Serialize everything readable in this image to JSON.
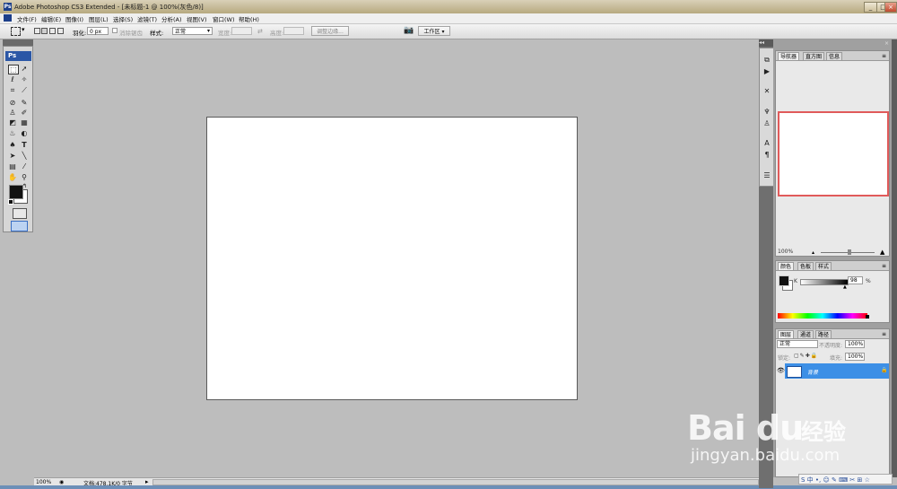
{
  "window": {
    "title": "Adobe Photoshop CS3 Extended - [未标题-1 @ 100%(灰色/8)]",
    "app_badge": "Ps",
    "controls": [
      "_",
      "□",
      "×"
    ]
  },
  "menu": [
    "文件(F)",
    "编辑(E)",
    "图像(I)",
    "图层(L)",
    "选择(S)",
    "滤镜(T)",
    "分析(A)",
    "视图(V)",
    "窗口(W)",
    "帮助(H)"
  ],
  "options": {
    "feather_label": "羽化:",
    "feather_value": "0 px",
    "antialias_label": "消除锯齿",
    "style_label": "样式:",
    "style_value": "正常",
    "width_label": "宽度:",
    "height_label": "高度:",
    "refine_edge_button": "调整边缘...",
    "workspace_button": "工作区 ▾"
  },
  "status": {
    "zoom": "100%",
    "doc_info": "文档:478.1K/0 字节"
  },
  "navigator": {
    "tabs": [
      "导航器",
      "直方图",
      "信息"
    ],
    "zoom": "100%"
  },
  "color_panel": {
    "tabs": [
      "颜色",
      "色板",
      "样式"
    ],
    "channel_label": "K",
    "value": "98",
    "unit": "%"
  },
  "layers_panel": {
    "tabs": [
      "图层",
      "通道",
      "路径"
    ],
    "blend_mode": "正常",
    "opacity_label": "不透明度:",
    "opacity_value": "100%",
    "lock_label": "锁定:",
    "fill_label": "填充:",
    "fill_value": "100%",
    "layer_name": "背景"
  },
  "watermark": {
    "brand": "Bai  du",
    "brand_cn": "经验",
    "url": "jingyan.baidu.com"
  },
  "ime_bar": "S 中 •, ☺ ✎ ⌨ ✂ ⊞ ☆",
  "colors": {
    "workspace": "#bdbdbd",
    "selected_layer": "#3c8fe6",
    "navigator_frame": "#e05a5a",
    "ps_blue": "#2b57a6"
  }
}
